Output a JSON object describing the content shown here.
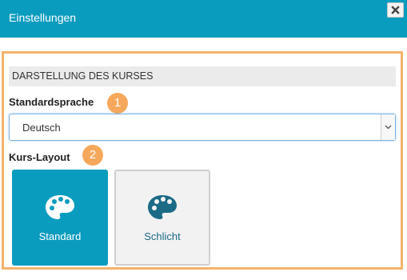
{
  "window": {
    "title": "Einstellungen",
    "close_icon": "close-icon"
  },
  "section": {
    "title": "DARSTELLUNG DES KURSES"
  },
  "language": {
    "label": "Standardsprache",
    "badge": "1",
    "selected_value": "Deutsch"
  },
  "layout": {
    "label": "Kurs-Layout",
    "badge": "2",
    "options": [
      {
        "label": "Standard",
        "icon": "palette-icon",
        "selected": true
      },
      {
        "label": "Schlicht",
        "icon": "palette-icon",
        "selected": false
      }
    ]
  },
  "colors": {
    "accent": "#0a9cbe",
    "highlight": "#f4b36b",
    "badge": "#f5a85c"
  }
}
